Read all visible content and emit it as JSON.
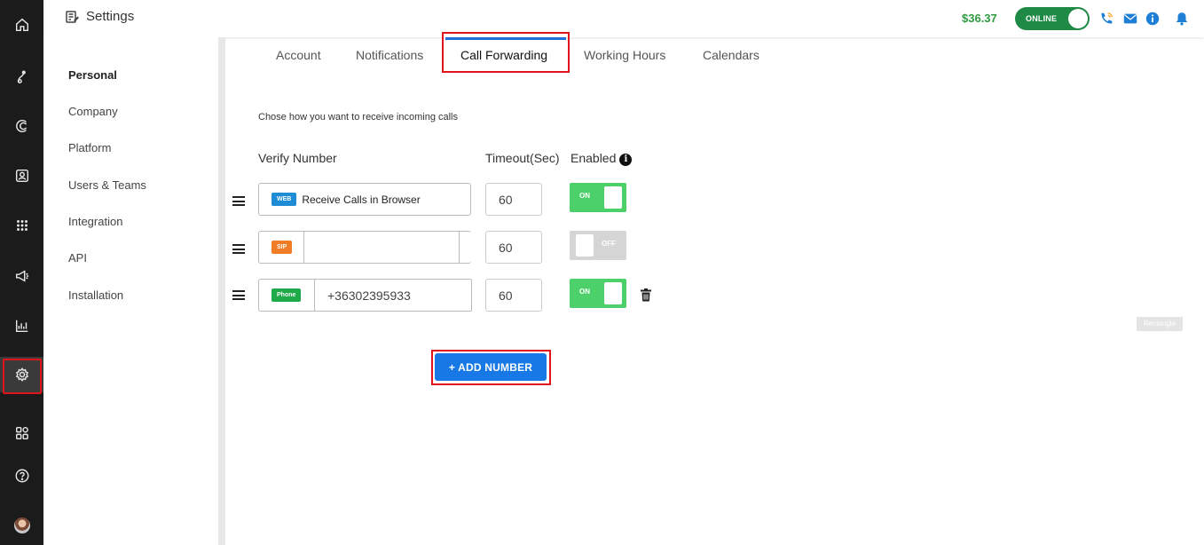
{
  "rail": {
    "items": [
      "home",
      "routing",
      "calls",
      "contacts",
      "dialpad",
      "campaigns",
      "reports",
      "settings",
      "apps",
      "help",
      "profile"
    ],
    "active": "settings"
  },
  "header": {
    "title": "Settings",
    "balance": "$36.37",
    "status_label": "ONLINE"
  },
  "subnav": {
    "items": [
      {
        "label": "Personal",
        "active": true
      },
      {
        "label": "Company"
      },
      {
        "label": "Platform"
      },
      {
        "label": "Users & Teams"
      },
      {
        "label": "Integration"
      },
      {
        "label": "API"
      },
      {
        "label": "Installation"
      }
    ]
  },
  "tabs": {
    "items": [
      "Account",
      "Notifications",
      "Call Forwarding",
      "Working Hours",
      "Calendars"
    ],
    "active": "Call Forwarding"
  },
  "content": {
    "intro": "Chose how you want to receive incoming calls",
    "col_verify": "Verify Number",
    "col_timeout": "Timeout(Sec)",
    "col_enabled": "Enabled",
    "rows": [
      {
        "badge": "WEB",
        "text": "Receive Calls in Browser",
        "timeout": "60",
        "switch_label": "ON",
        "enabled": true
      },
      {
        "badge": "SIP",
        "text": "",
        "timeout": "60",
        "switch_label": "OFF",
        "enabled": false
      },
      {
        "badge": "Phone",
        "text": "+36302395933",
        "timeout": "60",
        "switch_label": "ON",
        "enabled": true
      }
    ],
    "add_button": "+ ADD NUMBER",
    "rectangle_label": "Rectangle"
  },
  "colors": {
    "accent": "#1778e6",
    "online": "#1e8a45",
    "switch_on": "#4cd06a",
    "highlight": "#e0141b"
  }
}
